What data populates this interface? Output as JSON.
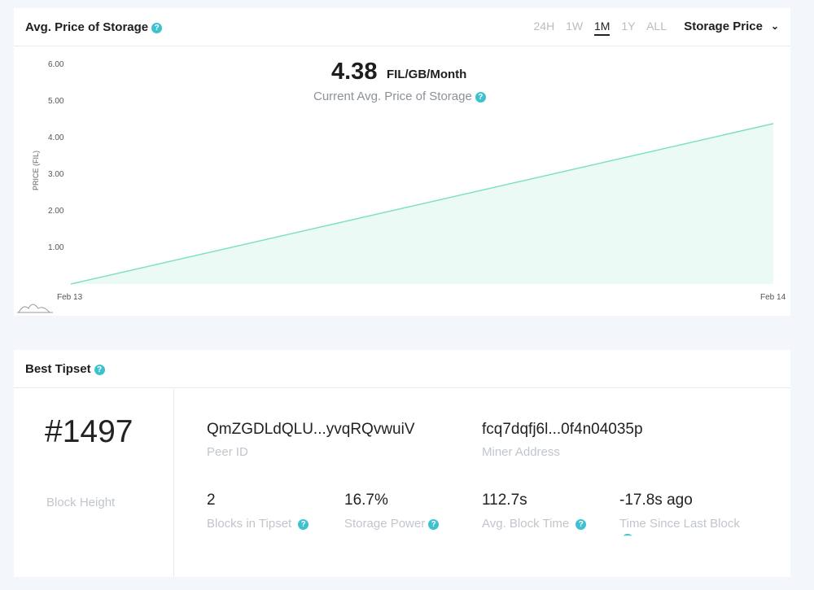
{
  "price_card": {
    "title": "Avg. Price of Storage",
    "help_icon": "?",
    "ranges": [
      "24H",
      "1W",
      "1M",
      "1Y",
      "ALL"
    ],
    "active_range": "1M",
    "dropdown_label": "Storage Price",
    "current_value": "4.38",
    "current_unit": "FIL/GB/Month",
    "current_caption": "Current Avg. Price of Storage",
    "accent_color": "#3ec1cf"
  },
  "chart_data": {
    "type": "area",
    "x": [
      "Feb 13",
      "Feb 14"
    ],
    "values": [
      0.0,
      4.38
    ],
    "xlabel": "",
    "ylabel": "PRICE (FIL)",
    "ylim": [
      0,
      6
    ],
    "yticks": [
      "1.00",
      "2.00",
      "3.00",
      "4.00",
      "5.00",
      "6.00"
    ],
    "xticks": [
      "Feb 13",
      "Feb 14"
    ],
    "line_color": "#7fe0c4",
    "fill_color": "#ebfaf4",
    "grid": false
  },
  "tipset_card": {
    "title": "Best Tipset",
    "block_height": "#1497",
    "block_height_label": "Block Height",
    "peer_id": "QmZGDLdQLU...yvqRQvwuiV",
    "peer_id_label": "Peer ID",
    "miner_address": "fcq7dqfj6l...0f4n04035p",
    "miner_address_label": "Miner Address",
    "blocks_in_tipset": "2",
    "blocks_in_tipset_label": "Blocks in Tipset",
    "storage_power": "16.7%",
    "storage_power_label": "Storage Power",
    "avg_block_time": "112.7s",
    "avg_block_time_label": "Avg. Block Time",
    "time_since_last_block": "-17.8s ago",
    "time_since_last_block_label": "Time Since Last Block"
  }
}
